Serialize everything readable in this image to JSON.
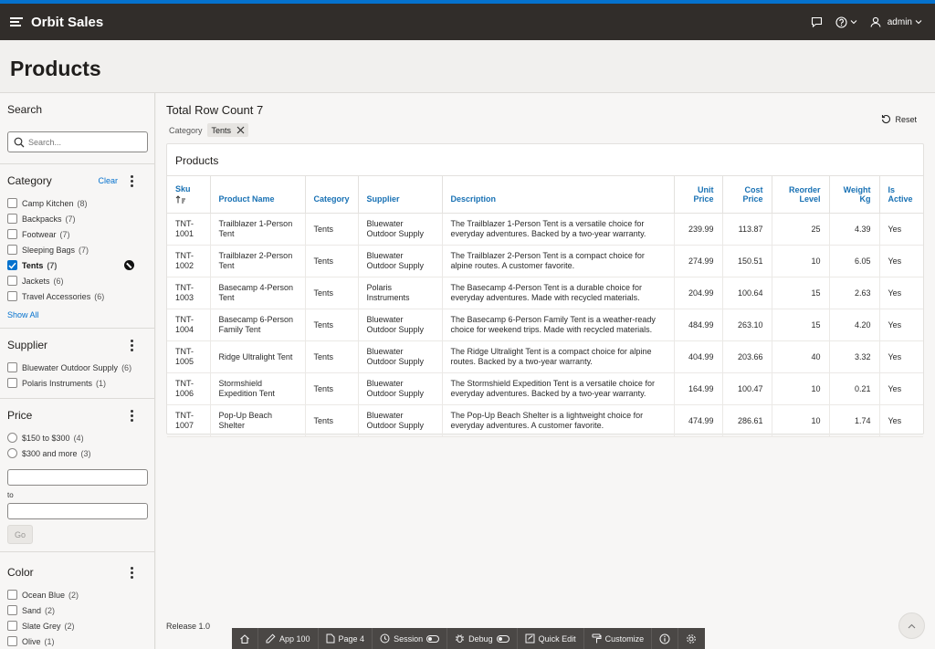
{
  "app": {
    "title": "Orbit Sales",
    "user": "admin"
  },
  "page": {
    "title": "Products"
  },
  "search": {
    "title": "Search",
    "placeholder": "Search..."
  },
  "facets": {
    "category": {
      "title": "Category",
      "clear_label": "Clear",
      "items": [
        {
          "label": "Camp Kitchen",
          "count": "(8)",
          "checked": false
        },
        {
          "label": "Backpacks",
          "count": "(7)",
          "checked": false
        },
        {
          "label": "Footwear",
          "count": "(7)",
          "checked": false
        },
        {
          "label": "Sleeping Bags",
          "count": "(7)",
          "checked": false
        },
        {
          "label": "Tents",
          "count": "(7)",
          "checked": true
        },
        {
          "label": "Jackets",
          "count": "(6)",
          "checked": false
        },
        {
          "label": "Travel Accessories",
          "count": "(6)",
          "checked": false
        }
      ],
      "show_all": "Show All"
    },
    "supplier": {
      "title": "Supplier",
      "items": [
        {
          "label": "Bluewater Outdoor Supply",
          "count": "(6)"
        },
        {
          "label": "Polaris Instruments",
          "count": "(1)"
        }
      ]
    },
    "price": {
      "title": "Price",
      "items": [
        {
          "label": "$150 to $300",
          "count": "(4)"
        },
        {
          "label": "$300 and more",
          "count": "(3)"
        }
      ],
      "to_label": "to",
      "go_label": "Go"
    },
    "color": {
      "title": "Color",
      "items": [
        {
          "label": "Ocean Blue",
          "count": "(2)"
        },
        {
          "label": "Sand",
          "count": "(2)"
        },
        {
          "label": "Slate Grey",
          "count": "(2)"
        },
        {
          "label": "Olive",
          "count": "(1)"
        }
      ]
    }
  },
  "results": {
    "row_count_label": "Total Row Count 7",
    "reset_label": "Reset",
    "filter_label": "Category",
    "filter_chip": "Tents"
  },
  "report": {
    "title": "Products",
    "columns": [
      {
        "label": "Sku",
        "numeric": false
      },
      {
        "label": "Product Name",
        "numeric": false
      },
      {
        "label": "Category",
        "numeric": false
      },
      {
        "label": "Supplier",
        "numeric": false
      },
      {
        "label": "Description",
        "numeric": false
      },
      {
        "label": "Unit\nPrice",
        "numeric": true
      },
      {
        "label": "Cost\nPrice",
        "numeric": true
      },
      {
        "label": "Reorder\nLevel",
        "numeric": true
      },
      {
        "label": "Weight\nKg",
        "numeric": true
      },
      {
        "label": "Is\nActive",
        "numeric": false
      }
    ],
    "rows": [
      [
        "TNT-\n1001",
        "Trailblazer 1-Person\nTent",
        "Tents",
        "Bluewater\nOutdoor Supply",
        "The Trailblazer 1-Person Tent is a versatile choice for\neveryday adventures. Backed by a two-year warranty.",
        "239.99",
        "113.87",
        "25",
        "4.39",
        "Yes"
      ],
      [
        "TNT-\n1002",
        "Trailblazer 2-Person\nTent",
        "Tents",
        "Bluewater\nOutdoor Supply",
        "The Trailblazer 2-Person Tent is a compact choice for\nalpine routes. A customer favorite.",
        "274.99",
        "150.51",
        "10",
        "6.05",
        "Yes"
      ],
      [
        "TNT-\n1003",
        "Basecamp 4-Person\nTent",
        "Tents",
        "Polaris\nInstruments",
        "The Basecamp 4-Person Tent is a durable choice for\neveryday adventures. Made with recycled materials.",
        "204.99",
        "100.64",
        "15",
        "2.63",
        "Yes"
      ],
      [
        "TNT-\n1004",
        "Basecamp 6-Person\nFamily Tent",
        "Tents",
        "Bluewater\nOutdoor Supply",
        "The Basecamp 6-Person Family Tent is a weather-ready\nchoice for weekend trips. Made with recycled materials.",
        "484.99",
        "263.10",
        "15",
        "4.20",
        "Yes"
      ],
      [
        "TNT-\n1005",
        "Ridge Ultralight Tent",
        "Tents",
        "Bluewater\nOutdoor Supply",
        "The Ridge Ultralight Tent is a compact choice for alpine\nroutes. Backed by a two-year warranty.",
        "404.99",
        "203.66",
        "40",
        "3.32",
        "Yes"
      ],
      [
        "TNT-\n1006",
        "Stormshield\nExpedition Tent",
        "Tents",
        "Bluewater\nOutdoor Supply",
        "The Stormshield Expedition Tent is a versatile choice for\neveryday adventures. Backed by a two-year warranty.",
        "164.99",
        "100.47",
        "10",
        "0.21",
        "Yes"
      ],
      [
        "TNT-\n1007",
        "Pop-Up Beach\nShelter",
        "Tents",
        "Bluewater\nOutdoor Supply",
        "The Pop-Up Beach Shelter is a lightweight choice for\neveryday adventures. A customer favorite.",
        "474.99",
        "286.61",
        "10",
        "1.74",
        "Yes"
      ]
    ]
  },
  "footer": {
    "release": "Release 1.0"
  },
  "devbar": {
    "app": "App 100",
    "page": "Page 4",
    "session": "Session",
    "debug": "Debug",
    "quick_edit": "Quick Edit",
    "customize": "Customize"
  },
  "colors": {
    "header": "#312d2a",
    "accent": "#0572ce",
    "link": "#1871b4"
  }
}
